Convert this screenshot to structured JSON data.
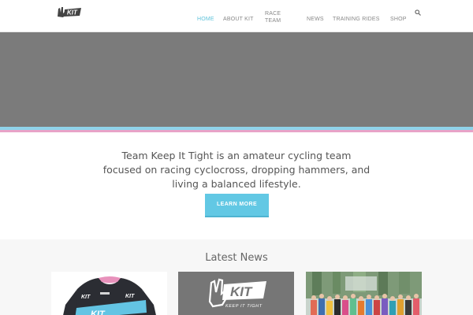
{
  "header": {
    "logo_alt": "KIT",
    "nav": [
      {
        "label": "HOME",
        "active": true
      },
      {
        "label": "ABOUT KIT",
        "active": false
      },
      {
        "label": "RACE",
        "label2": "TEAM",
        "active": false
      },
      {
        "label": "NEWS",
        "active": false
      },
      {
        "label": "TRAINING RIDES",
        "active": false
      },
      {
        "label": "SHOP",
        "active": false
      }
    ],
    "search_icon": "search-icon"
  },
  "intro": {
    "text": "Team Keep It Tight is an amateur cycling team focused on racing cyclocross, dropping hammers, and living a balanced lifestyle.",
    "button_label": "LEARN MORE"
  },
  "news": {
    "title": "Latest News",
    "cards": [
      {
        "image": "jersey-photo"
      },
      {
        "image": "kit-logo-graphic",
        "logo_text": "KIT",
        "tagline": "KEEP IT TIGHT"
      },
      {
        "image": "group-ride-photo"
      }
    ]
  },
  "colors": {
    "accent": "#5fc2da",
    "button": "#62c8e4",
    "stripe_blue": "#8fd3ea",
    "stripe_pink": "#e8a3c8",
    "hero": "#7b7b7b"
  }
}
